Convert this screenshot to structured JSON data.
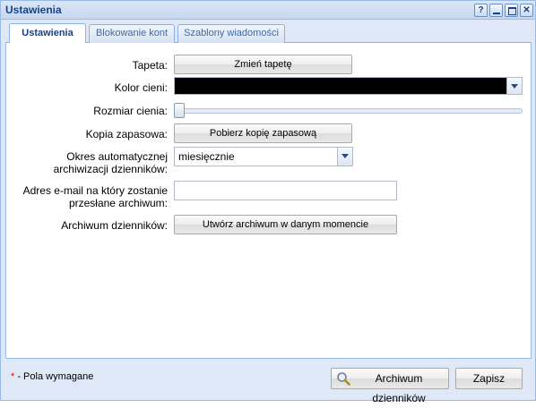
{
  "window": {
    "title": "Ustawienia",
    "tools": [
      "help-icon",
      "minimize-icon",
      "maximize-icon",
      "close-icon"
    ]
  },
  "tabs": [
    {
      "label": "Ustawienia",
      "active": true
    },
    {
      "label": "Blokowanie kont",
      "active": false
    },
    {
      "label": "Szablony wiadomości",
      "active": false
    }
  ],
  "form": {
    "wallpaper": {
      "label": "Tapeta:",
      "button": "Zmień tapetę"
    },
    "shadow_color": {
      "label": "Kolor cieni:",
      "value": "#000000"
    },
    "shadow_size": {
      "label": "Rozmiar cienia:",
      "value": 0
    },
    "backup": {
      "label": "Kopia zapasowa:",
      "button": "Pobierz kopię zapasową"
    },
    "archive_period": {
      "label_line1": "Okres automatycznej",
      "label_line2": "archiwizacji dzienników:",
      "value": "miesięcznie"
    },
    "email": {
      "label_line1": "Adres e-mail na który zostanie",
      "label_line2": "przesłane archiwum:",
      "value": ""
    },
    "log_archive": {
      "label": "Archiwum dzienników:",
      "button": "Utwórz archiwum w danym momencie"
    }
  },
  "footer": {
    "required_star": "*",
    "required_text": " - Pola wymagane",
    "archive_button": "Archiwum dzienników",
    "save_button": "Zapisz"
  },
  "colors": {
    "header_text": "#15428b",
    "border": "#99bbe8",
    "panel_bg": "#dfe8f6"
  }
}
